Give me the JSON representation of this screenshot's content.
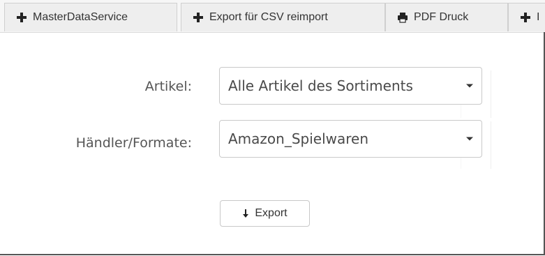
{
  "tabs": [
    {
      "label": "MasterDataService",
      "icon": "plus-icon"
    },
    {
      "label": "Export für CSV reimport",
      "icon": "plus-icon"
    },
    {
      "label": "PDF Druck",
      "icon": "print-icon"
    },
    {
      "label": "I",
      "icon": "plus-icon"
    }
  ],
  "form": {
    "artikel_label": "Artikel:",
    "artikel_value": "Alle Artikel des Sortiments",
    "haendler_label": "Händler/Formate:",
    "haendler_value": "Amazon_Spielwaren",
    "export_label": "Export",
    "export_icon": "download-arrow-icon"
  }
}
